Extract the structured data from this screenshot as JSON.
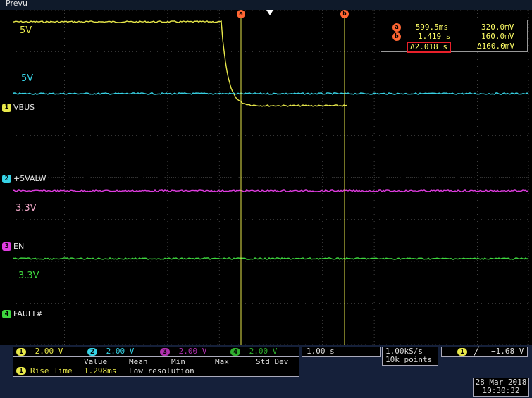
{
  "status": {
    "label": "Prevu"
  },
  "colors": {
    "ch1": "#e8e84a",
    "ch2": "#37d3e6",
    "ch3": "#e03ce0",
    "ch4": "#3ed63e",
    "cursor": "#ff6633",
    "grid": "#6a6a6a"
  },
  "channels": [
    {
      "num": "1",
      "name": "VBUS",
      "level_text": "5V",
      "scale": "2.00 V",
      "color": "#e8e84a"
    },
    {
      "num": "2",
      "name": "+5VALW",
      "level_text": "5V",
      "scale": "2.00 V",
      "color": "#37d3e6"
    },
    {
      "num": "3",
      "name": "EN",
      "level_text": "3.3V",
      "scale": "2.00 V",
      "color": "#e03ce0"
    },
    {
      "num": "4",
      "name": "FAULT#",
      "level_text": "3.3V",
      "scale": "2.00 V",
      "color": "#3ed63e"
    }
  ],
  "cursors": {
    "a_label": "a",
    "b_label": "b",
    "a_time": "−599.5ms",
    "a_volt": "320.0mV",
    "b_time": "1.419 s",
    "b_volt": "160.0mV",
    "delta_time": "Δ2.018 s",
    "delta_volt": "Δ160.0mV"
  },
  "measurement": {
    "headers": [
      "Value",
      "Mean",
      "Min",
      "Max",
      "Std Dev"
    ],
    "num": "1",
    "name": "Rise Time",
    "value": "1.298ms",
    "note": "Low resolution"
  },
  "horizontal": {
    "time_per_div": "1.00 s"
  },
  "acquisition": {
    "rate": "1.00kS/s",
    "points": "10k points"
  },
  "trigger": {
    "channel": "1",
    "slope_icon": "rising-edge",
    "slope_glyph": "╱",
    "level": "−1.68 V"
  },
  "datetime": {
    "date": "28 Mar 2018",
    "time": "10:30:32"
  }
}
